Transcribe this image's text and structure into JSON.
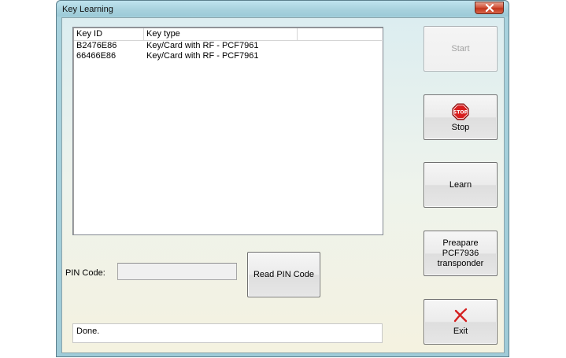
{
  "window": {
    "title": "Key Learning"
  },
  "listview": {
    "columns": [
      "Key ID",
      "Key type",
      ""
    ],
    "rows": [
      {
        "key_id": "B2476E86",
        "key_type": "Key/Card with RF - PCF7961"
      },
      {
        "key_id": "66466E86",
        "key_type": "Key/Card with RF - PCF7961"
      }
    ]
  },
  "pin": {
    "label": "PIN Code:",
    "value": ""
  },
  "buttons": {
    "read_pin": "Read PIN Code",
    "start": "Start",
    "stop": "Stop",
    "stop_sign_text": "STOP",
    "learn": "Learn",
    "prepare": "Preapare PCF7936 transponder",
    "exit": "Exit"
  },
  "status": {
    "text": "Done."
  },
  "icons": {
    "close": "close-icon",
    "stop": "stop-sign-icon",
    "exit": "red-x-icon"
  },
  "colors": {
    "stop_red": "#d81e1e",
    "exit_red": "#d42020"
  }
}
